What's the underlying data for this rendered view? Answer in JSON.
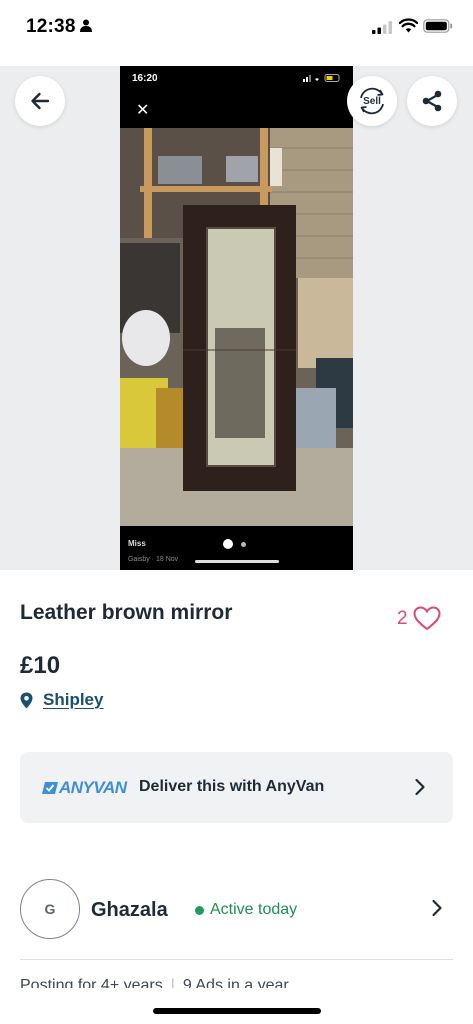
{
  "status_bar": {
    "time": "12:38",
    "icons": [
      "person-icon",
      "signal-icon",
      "wifi-icon",
      "battery-icon"
    ]
  },
  "gallery": {
    "screenshot_time": "16:20",
    "photo_user": "Miss",
    "photo_sub": "Gaisby · 18 Nov",
    "page_count": 2,
    "current_page": 1,
    "buttons": {
      "back_icon": "arrow-left-icon",
      "sell_label": "Sell",
      "share_icon": "share-icon"
    }
  },
  "listing": {
    "title": "Leather brown mirror",
    "favorites_count": "2",
    "price": "£10",
    "location": "Shipley"
  },
  "delivery": {
    "logo_text": "ANYVAN",
    "text": "Deliver this with AnyVan"
  },
  "seller": {
    "initial": "G",
    "name": "Ghazala",
    "status": "Active today",
    "stats_left": "Posting for 4+ years",
    "stats_right": "9 Ads in a year"
  },
  "colors": {
    "accent_link": "#1a4f6e",
    "favorite": "#e0467c",
    "active": "#1e9e5a",
    "anyvan_blue": "#3d8fd8"
  }
}
